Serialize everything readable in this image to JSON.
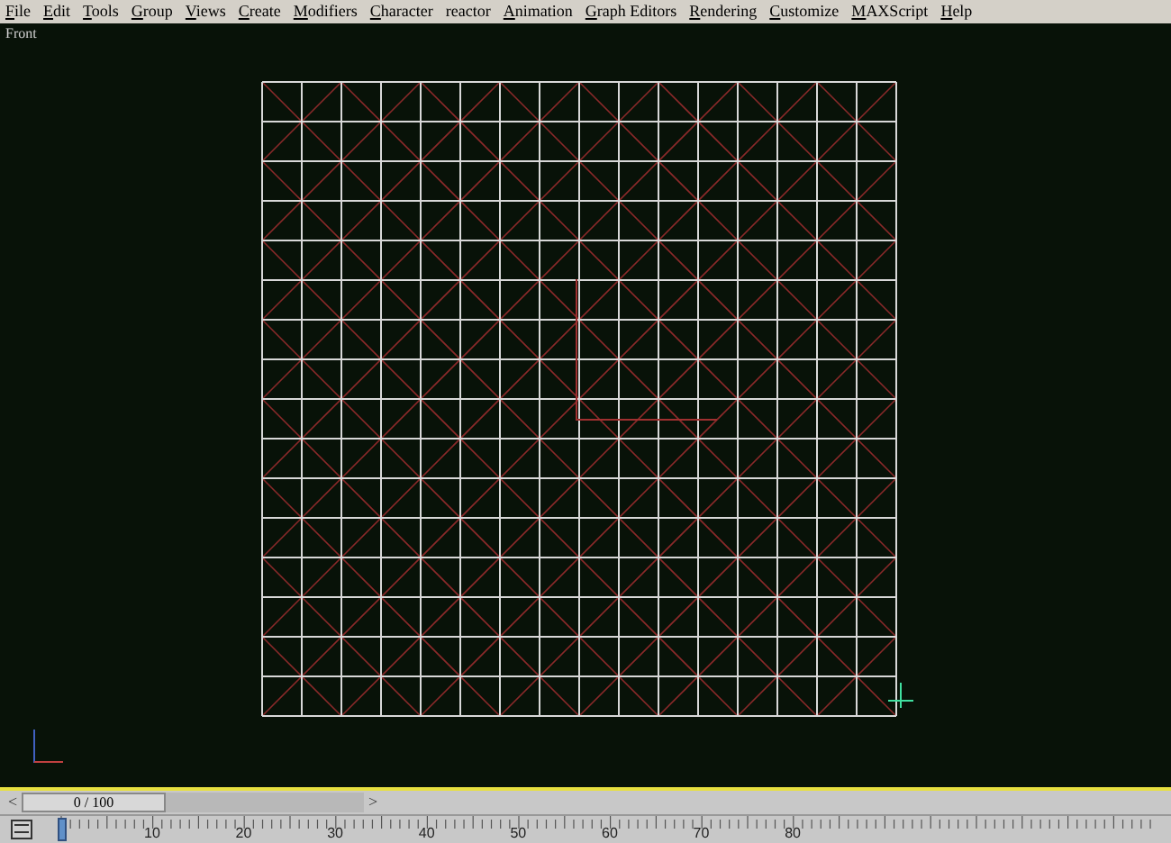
{
  "menu": [
    {
      "label": "File",
      "underline": true
    },
    {
      "label": "Edit",
      "underline": true
    },
    {
      "label": "Tools",
      "underline": true
    },
    {
      "label": "Group",
      "underline": true
    },
    {
      "label": "Views",
      "underline": true
    },
    {
      "label": "Create",
      "underline": true
    },
    {
      "label": "Modifiers",
      "underline": true
    },
    {
      "label": "Character",
      "underline": true
    },
    {
      "label": "reactor",
      "underline": false
    },
    {
      "label": "Animation",
      "underline": true
    },
    {
      "label": "Graph Editors",
      "underline": true
    },
    {
      "label": "Rendering",
      "underline": true
    },
    {
      "label": "Customize",
      "underline": true
    },
    {
      "label": "MAXScript",
      "underline": true
    },
    {
      "label": "Help",
      "underline": true
    }
  ],
  "viewport": {
    "label": "Front"
  },
  "time_slider": {
    "prev": "<",
    "position": "0 / 100",
    "next": ">",
    "level": 0
  },
  "timeline": {
    "ticks": [
      "10",
      "20",
      "30",
      "40",
      "50",
      "60",
      "70",
      "80"
    ]
  }
}
